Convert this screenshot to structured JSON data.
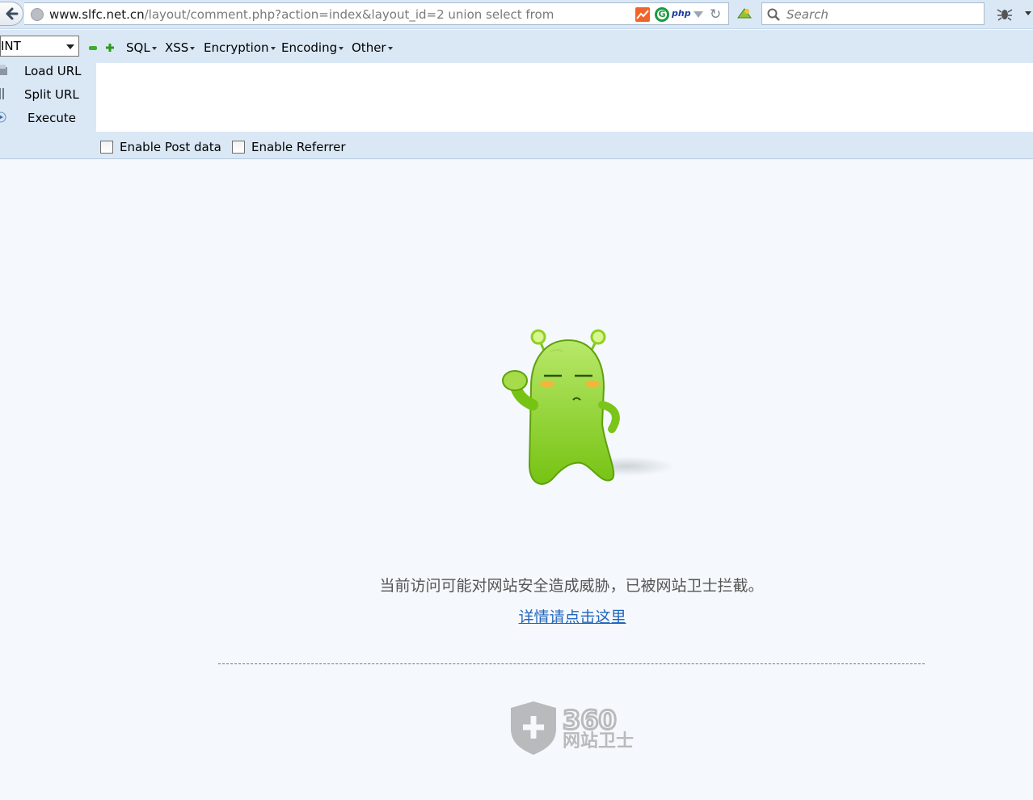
{
  "browser": {
    "url_host": "www.slfc.net.cn",
    "url_path": "/layout/comment.php?action=index&layout_id=2 union select from",
    "search_placeholder": "Search",
    "ext_php_label": "php",
    "ext_g_label": "G"
  },
  "hackbar": {
    "type_select": "INT",
    "menus": [
      "SQL",
      "XSS",
      "Encryption",
      "Encoding",
      "Other"
    ],
    "actions": {
      "load_url": "Load URL",
      "split_url": "Split URL",
      "execute": "Execute"
    },
    "checkboxes": {
      "post_data": "Enable Post data",
      "referrer": "Enable Referrer"
    },
    "url_value": ""
  },
  "page": {
    "message": "当前访问可能对网站安全造成威胁，已被网站卫士拦截。",
    "link_text": "详情请点击这里",
    "logo_number": "360",
    "logo_text": "网站卫士"
  },
  "colors": {
    "toolbar_bg": "#dae8f6",
    "page_bg": "#f5f9fd",
    "link": "#2266bb",
    "mascot_green": "#8fd11f",
    "logo_gray": "#b8babc"
  },
  "icons": [
    "back-arrow-icon",
    "globe-icon",
    "chart-icon",
    "g-icon",
    "dropdown-icon",
    "reload-icon",
    "addon-icon",
    "search-icon",
    "bug-icon",
    "menu-icon",
    "minus-icon",
    "plus-icon",
    "load-url-icon",
    "split-url-icon",
    "execute-icon"
  ]
}
